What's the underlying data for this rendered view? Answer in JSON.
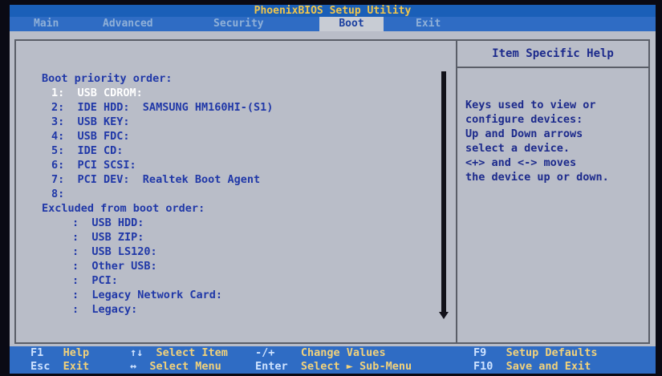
{
  "title": "PhoenixBIOS Setup Utility",
  "menu": [
    {
      "label": "Main"
    },
    {
      "label": "Advanced"
    },
    {
      "label": "Security"
    },
    {
      "label": "Boot"
    },
    {
      "label": "Exit"
    }
  ],
  "active_tab": "Boot",
  "boot": {
    "priority_heading": "Boot priority order:",
    "priority": [
      {
        "num": "1:",
        "label": "USB CDROM:",
        "selected": true
      },
      {
        "num": "2:",
        "label": "IDE HDD:  SAMSUNG HM160HI-(S1)"
      },
      {
        "num": "3:",
        "label": "USB KEY:"
      },
      {
        "num": "4:",
        "label": "USB FDC:"
      },
      {
        "num": "5:",
        "label": "IDE CD:"
      },
      {
        "num": "6:",
        "label": "PCI SCSI:"
      },
      {
        "num": "7:",
        "label": "PCI DEV:  Realtek Boot Agent"
      },
      {
        "num": "8:",
        "label": ""
      }
    ],
    "excluded_heading": "Excluded from boot order:",
    "excluded": [
      {
        "num": ":",
        "label": "USB HDD:"
      },
      {
        "num": ":",
        "label": "USB ZIP:"
      },
      {
        "num": ":",
        "label": "USB LS120:"
      },
      {
        "num": ":",
        "label": "Other USB:"
      },
      {
        "num": ":",
        "label": "PCI:"
      },
      {
        "num": ":",
        "label": "Legacy Network Card:"
      },
      {
        "num": ":",
        "label": "Legacy:"
      }
    ]
  },
  "help": {
    "title": "Item Specific Help",
    "lines": [
      "Keys used to view or",
      "configure devices:",
      "Up and Down arrows",
      "select a device.",
      "<+> and <-> moves",
      "the device up or down."
    ]
  },
  "footer": {
    "row1": [
      {
        "key": "F1",
        "desc": "Help"
      },
      {
        "key": "↑↓",
        "desc": "Select Item"
      },
      {
        "key": "-/+",
        "desc": "Change Values"
      },
      {
        "key": "F9",
        "desc": "Setup Defaults"
      }
    ],
    "row2": [
      {
        "key": "Esc",
        "desc": "Exit"
      },
      {
        "key": "↔",
        "desc": "Select Menu"
      },
      {
        "key": "Enter",
        "desc": "Select ► Sub-Menu"
      },
      {
        "key": "F10",
        "desc": "Save and Exit"
      }
    ]
  },
  "colors": {
    "menubar": "#2f6cc4",
    "title_text": "#f2c64a",
    "panel_bg": "#b9bdc8",
    "item_text": "#2038a8",
    "selected_text": "#ffffff"
  }
}
